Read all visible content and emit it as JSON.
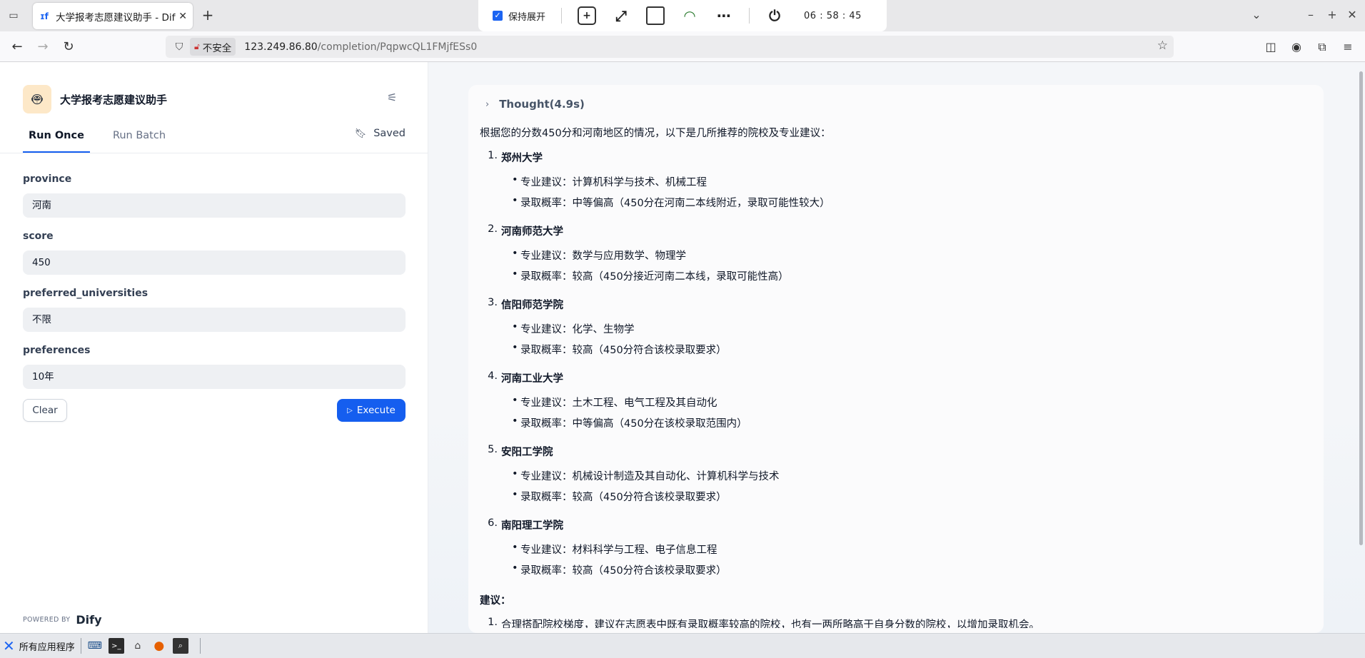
{
  "browser": {
    "tab_title": "大学报考志愿建议助手 - Dify",
    "tab_favicon": "dify-icon",
    "url_security": "不安全",
    "url_host": "123.249.86.80",
    "url_path": "/completion/PqpwcQL1FMjfESs0"
  },
  "float_toolbar": {
    "keep_expanded_label": "保持展开",
    "clock": "06 : 58 : 45"
  },
  "app": {
    "name": "大学报考志愿建议助手",
    "icon": "robot-icon",
    "tabs": {
      "run_once": "Run Once",
      "run_batch": "Run Batch",
      "saved": "Saved"
    },
    "fields": [
      {
        "label": "province",
        "value": "河南"
      },
      {
        "label": "score",
        "value": "450"
      },
      {
        "label": "preferred_universities",
        "value": "不限"
      },
      {
        "label": "preferences",
        "value": "10年"
      }
    ],
    "clear_label": "Clear",
    "execute_label": "Execute",
    "powered_by": "POWERED BY",
    "brand": "Dify"
  },
  "result": {
    "thought_label": "Thought(4.9s)",
    "intro": "根据您的分数450分和河南地区的情况，以下是几所推荐的院校及专业建议：",
    "universities": [
      {
        "num": "1.",
        "name": "郑州大学",
        "major": "专业建议：计算机科学与技术、机械工程",
        "rate": "录取概率：中等偏高（450分在河南二本线附近，录取可能性较大）"
      },
      {
        "num": "2.",
        "name": "河南师范大学",
        "major": "专业建议：数学与应用数学、物理学",
        "rate": "录取概率：较高（450分接近河南二本线，录取可能性高）"
      },
      {
        "num": "3.",
        "name": "信阳师范学院",
        "major": "专业建议：化学、生物学",
        "rate": "录取概率：较高（450分符合该校录取要求）"
      },
      {
        "num": "4.",
        "name": "河南工业大学",
        "major": "专业建议：土木工程、电气工程及其自动化",
        "rate": "录取概率：中等偏高（450分在该校录取范围内）"
      },
      {
        "num": "5.",
        "name": "安阳工学院",
        "major": "专业建议：机械设计制造及其自动化、计算机科学与技术",
        "rate": "录取概率：较高（450分符合该校录取要求）"
      },
      {
        "num": "6.",
        "name": "南阳理工学院",
        "major": "专业建议：材料科学与工程、电子信息工程",
        "rate": "录取概率：较高（450分符合该校录取要求）"
      }
    ],
    "advice_label": "建议：",
    "advice_first_num": "1.",
    "advice_first": "合理搭配院校梯度，建议在志愿表中既有录取概率较高的院校，也有一两所略高于自身分数的院校，以增加录取机会。"
  },
  "taskbar": {
    "start_label": "所有应用程序"
  }
}
